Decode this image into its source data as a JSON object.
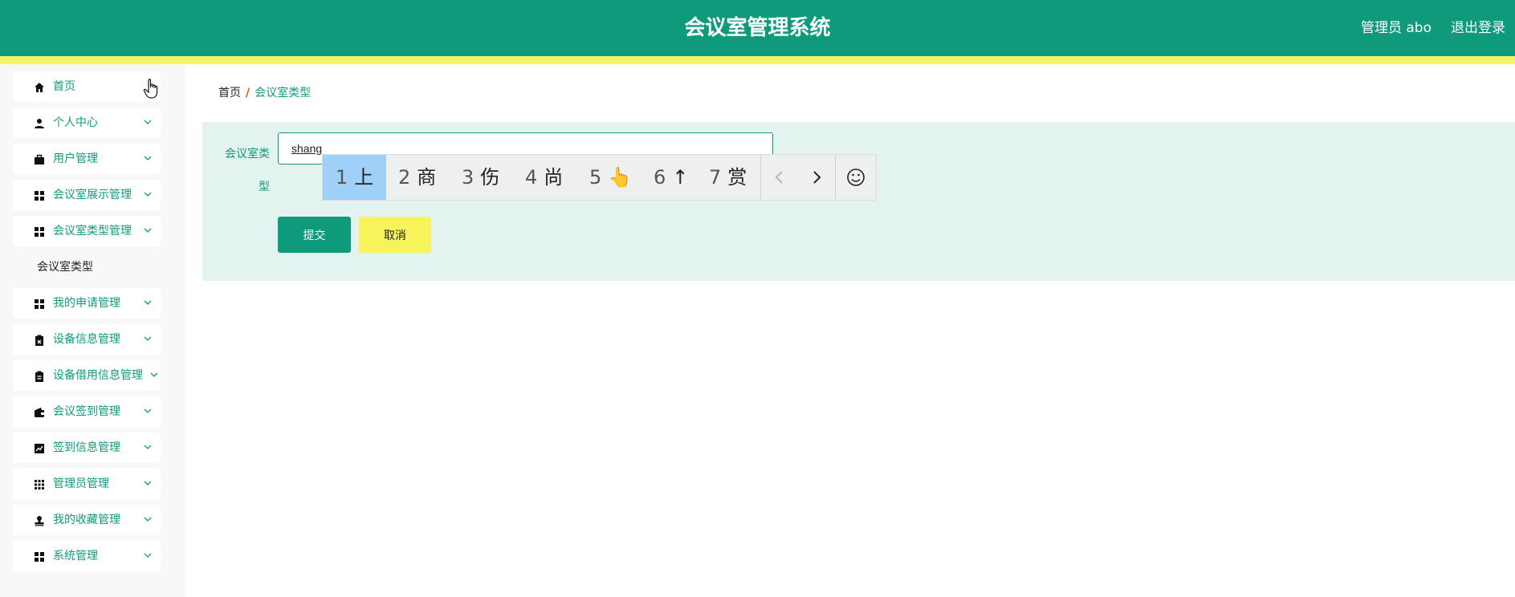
{
  "header": {
    "title": "会议室管理系统",
    "admin_label": "管理员 abo",
    "logout": "退出登录",
    "bg_color": "#0f9a7b",
    "stripe_color": "#f3f565"
  },
  "sidebar": {
    "items": [
      {
        "label": "首页",
        "icon": "home-icon"
      },
      {
        "label": "个人中心",
        "icon": "user-icon"
      },
      {
        "label": "用户管理",
        "icon": "briefcase-icon"
      },
      {
        "label": "会议室展示管理",
        "icon": "grid-icon"
      },
      {
        "label": "会议室类型管理",
        "icon": "grid-icon"
      },
      {
        "label": "我的申请管理",
        "icon": "grid-icon"
      },
      {
        "label": "设备信息管理",
        "icon": "clipboard-x-icon"
      },
      {
        "label": "设备借用信息管理",
        "icon": "clipboard-icon"
      },
      {
        "label": "会议签到管理",
        "icon": "wallet-icon"
      },
      {
        "label": "签到信息管理",
        "icon": "chart-line-icon"
      },
      {
        "label": "管理员管理",
        "icon": "apps-icon"
      },
      {
        "label": "我的收藏管理",
        "icon": "stamp-icon"
      },
      {
        "label": "系统管理",
        "icon": "grid-icon"
      }
    ],
    "submenu": {
      "label": "会议室类型"
    }
  },
  "breadcrumb": {
    "home": "首页",
    "separator": "/",
    "current": "会议室类型"
  },
  "form": {
    "field_label": "会议室类型",
    "input_value": "shang",
    "submit_label": "提交",
    "cancel_label": "取消"
  },
  "ime": {
    "candidates": [
      {
        "num": "1",
        "text": "上"
      },
      {
        "num": "2",
        "text": "商"
      },
      {
        "num": "3",
        "text": "伤"
      },
      {
        "num": "4",
        "text": "尚"
      },
      {
        "num": "5",
        "text": "👆"
      },
      {
        "num": "6",
        "text": "↑"
      },
      {
        "num": "7",
        "text": "赏"
      }
    ],
    "prev_icon": "chevron-left-icon",
    "next_icon": "chevron-right-icon",
    "emoji_icon": "smiley-icon"
  }
}
